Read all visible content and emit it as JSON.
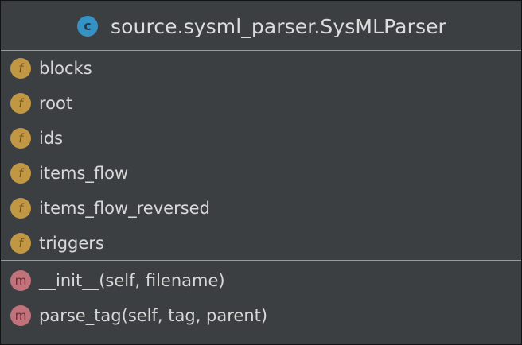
{
  "class_box": {
    "icon_letter": "c",
    "title": "source.sysml_parser.SysMLParser",
    "icon_color": "#3592c4"
  },
  "fields": [
    {
      "icon_letter": "f",
      "label": "blocks"
    },
    {
      "icon_letter": "f",
      "label": "root"
    },
    {
      "icon_letter": "f",
      "label": "ids"
    },
    {
      "icon_letter": "f",
      "label": "items_flow"
    },
    {
      "icon_letter": "f",
      "label": "items_flow_reversed"
    },
    {
      "icon_letter": "f",
      "label": "triggers"
    }
  ],
  "methods": [
    {
      "icon_letter": "m",
      "label": "__init__(self, filename)"
    },
    {
      "icon_letter": "m",
      "label": "parse_tag(self, tag, parent)"
    }
  ],
  "colors": {
    "background": "#3c3f41",
    "field_badge": "#c29744",
    "method_badge": "#c2727a",
    "separator": "#9a9c9e"
  }
}
